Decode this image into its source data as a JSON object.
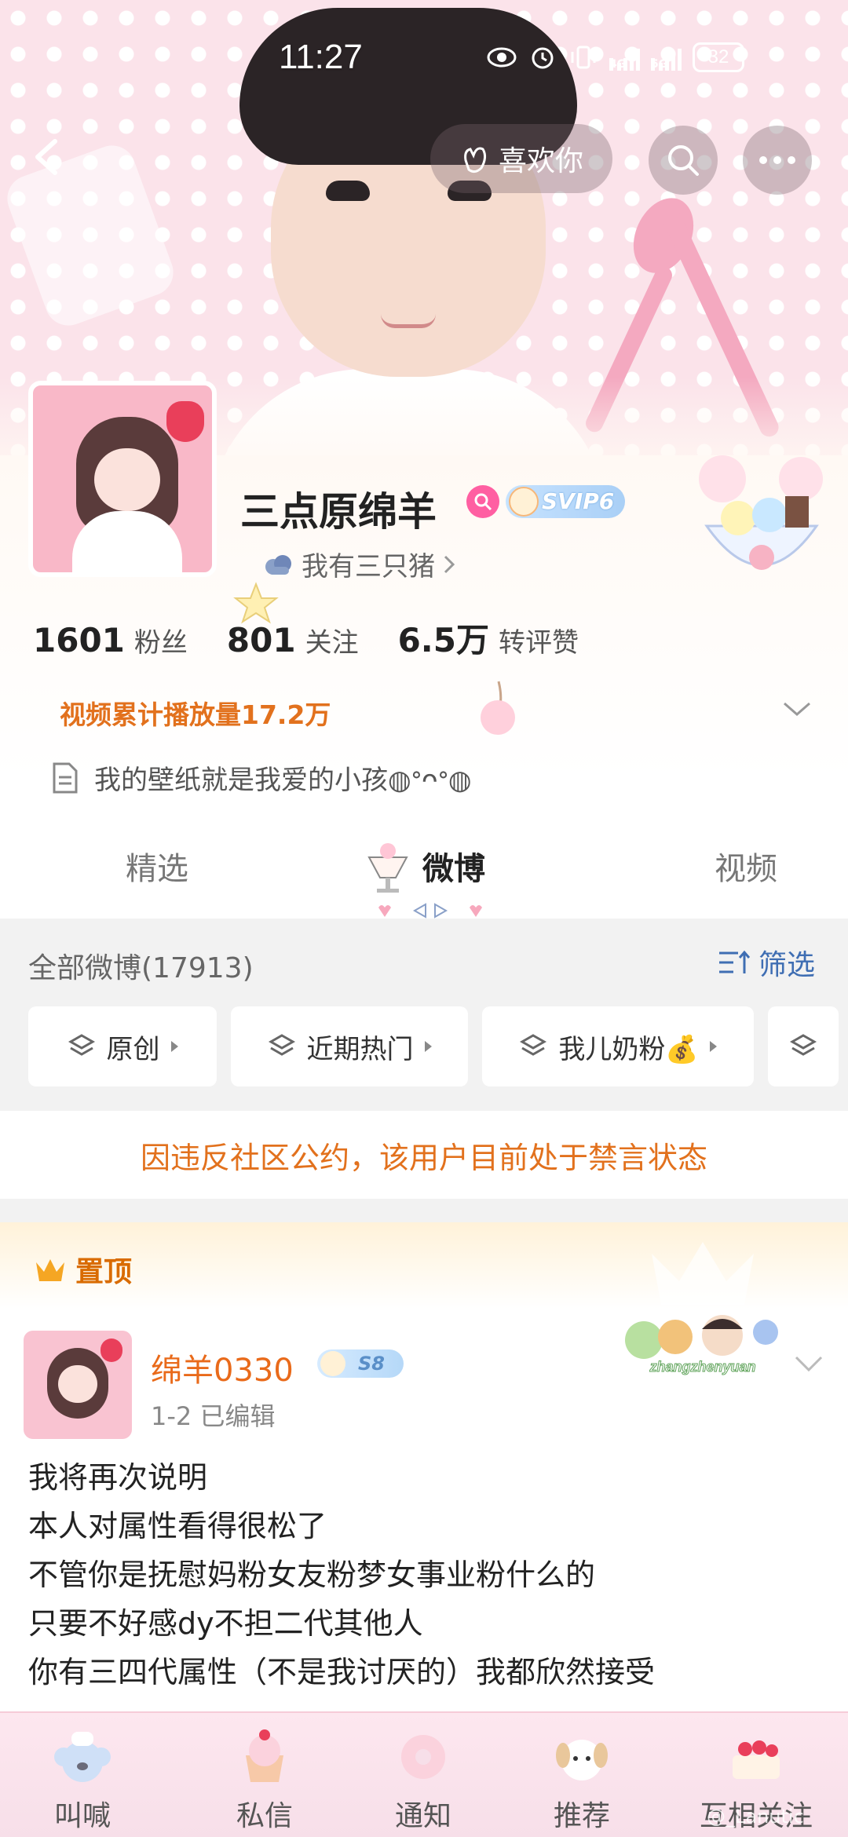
{
  "status_bar": {
    "time": "11:27",
    "signal_4g": "4G",
    "signal_5g": "5G",
    "battery": "32"
  },
  "top_nav": {
    "like_label": "喜欢你"
  },
  "profile": {
    "nickname": "三点原绵羊",
    "vip_label": "SVIP6",
    "sub_link": "我有三只猪",
    "stats": [
      {
        "value": "1601",
        "label": "粉丝"
      },
      {
        "value": "801",
        "label": "关注"
      },
      {
        "value": "6.5万",
        "label": "转评赞"
      }
    ],
    "video_stat": "视频累计播放量17.2万",
    "bio": "我的壁纸就是我爱的小孩◍ᐤᴖᐤ◍"
  },
  "tabs": [
    {
      "label": "精选",
      "active": false
    },
    {
      "label": "微博",
      "active": true
    },
    {
      "label": "视频",
      "active": false
    }
  ],
  "feed": {
    "count_label": "全部微博(17913)",
    "filter_label": "筛选",
    "chips": [
      "原创",
      "近期热门",
      "我儿奶粉💰",
      ""
    ],
    "banned_notice": "因违反社区公约，该用户目前处于禁言状态"
  },
  "pinned_post": {
    "pinned_label": "置顶",
    "author": "绵羊0330",
    "level_badge": "S8",
    "meta": "1-2  已编辑",
    "badge_text": "zhangzhenyuan",
    "lines": [
      "我将再次说明",
      "本人对属性看得很松了",
      "不管你是抚慰妈粉女友粉梦女事业粉什么的",
      "只要不好感dy不担二代其他人",
      "你有三四代属性（不是我讨厌的）我都欣然接受"
    ]
  },
  "bottom_bar": [
    "叫喊",
    "私信",
    "通知",
    "推荐",
    "互相关注"
  ],
  "watermark": "@_Lanutic",
  "colors": {
    "accent_orange": "#e2711d",
    "link_blue": "#3f6eb3",
    "pink": "#ff5fa2"
  }
}
